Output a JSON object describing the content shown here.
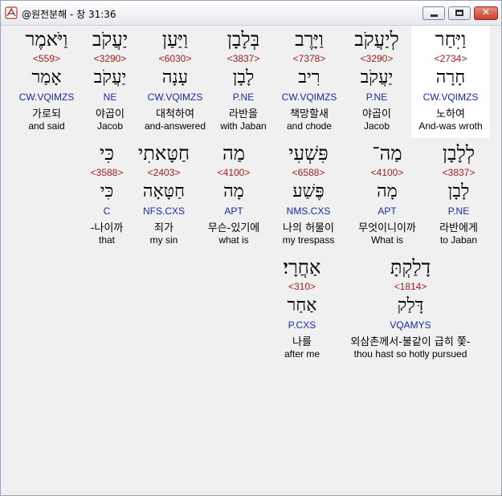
{
  "window": {
    "title": "@원전분해 - 창 31:36",
    "buttons": {
      "minimize": "minimize",
      "maximize": "maximize",
      "close": "✕"
    }
  },
  "rows": [
    {
      "words": [
        {
          "word": "וַיִּחַר",
          "strong": "<2734>",
          "root": "חָרָה",
          "morph": "CW.VQIMZS",
          "korean": "노하여",
          "english": "And-was wroth"
        },
        {
          "word": "לְיַעֲקֹב",
          "strong": "<3290>",
          "root": "יַעֲקֹב",
          "morph": "P.NE",
          "korean": "야곱이",
          "english": "Jacob"
        },
        {
          "word": "וַיָּרֶב",
          "strong": "<7378>",
          "root": "רִיב",
          "morph": "CW.VQIMZS",
          "korean": "책망할새",
          "english": "and chode"
        },
        {
          "word": "בְּלָבָן",
          "strong": "<3837>",
          "root": "לָבָן",
          "morph": "P.NE",
          "korean": "라반을",
          "english": "with Jaban"
        },
        {
          "word": "וַיַּעַן",
          "strong": "<6030>",
          "root": "עָנָה",
          "morph": "CW.VQIMZS",
          "korean": "대척하여",
          "english": "and-answered"
        },
        {
          "word": "יַעֲקֹב",
          "strong": "<3290>",
          "root": "יַעֲקֹב",
          "morph": "NE",
          "korean": "야곱이",
          "english": "Jacob"
        },
        {
          "word": "וַיֹּאמֶר",
          "strong": "<559>",
          "root": "אָמַר",
          "morph": "CW.VQIMZS",
          "korean": "가로되",
          "english": "and said"
        }
      ]
    },
    {
      "words": [
        {
          "word": "לְלָבָן",
          "strong": "<3837>",
          "root": "לָבָן",
          "morph": "P.NE",
          "korean": "라반에게",
          "english": "to Jaban"
        },
        {
          "word": "מַה־",
          "strong": "<4100>",
          "root": "מָה",
          "morph": "APT",
          "korean": "무엇이니이까",
          "english": "What is"
        },
        {
          "word": "פִּשְׁעִי",
          "strong": "<6588>",
          "root": "פֶּשַׁע",
          "morph": "NMS.CXS",
          "korean": "나의 허물이",
          "english": "my trespass"
        },
        {
          "word": "מַה",
          "strong": "<4100>",
          "root": "מָה",
          "morph": "APT",
          "korean": "무슨-있기에",
          "english": "what is"
        },
        {
          "word": "חַטָּאתִי",
          "strong": "<2403>",
          "root": "חַטָּאָה",
          "morph": "NFS.CXS",
          "korean": "죄가",
          "english": "my sin"
        },
        {
          "word": "כִּי",
          "strong": "<3588>",
          "root": "כִּי",
          "morph": "C",
          "korean": "-나이까",
          "english": "that"
        }
      ]
    },
    {
      "words": [
        {
          "word": "דָלַקְתָּ",
          "strong": "<1814>",
          "root": "דָּלַק",
          "morph": "VQAMYS",
          "korean": "외삼촌께서-불같이 급히 쫓-",
          "english": "thou hast so hotly pursued"
        },
        {
          "word": "אַחֲרָי׃",
          "strong": "<310>",
          "root": "אַחַר",
          "morph": "P.CXS",
          "korean": "나를",
          "english": "after me"
        }
      ]
    }
  ]
}
